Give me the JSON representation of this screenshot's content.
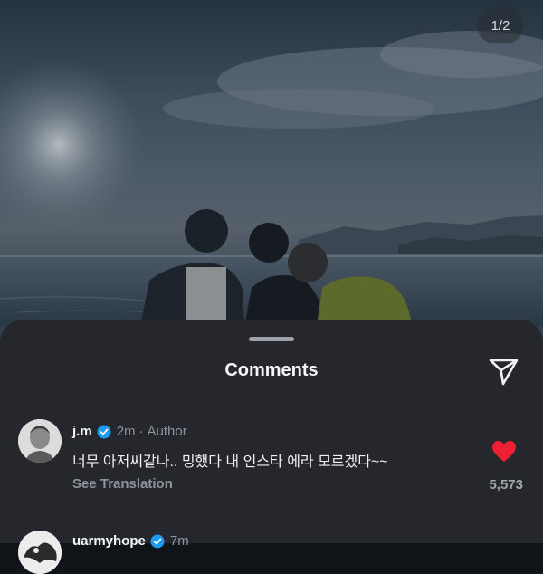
{
  "photo": {
    "counter": "1/2"
  },
  "comments_sheet": {
    "title": "Comments",
    "share_icon": "paper-plane-icon"
  },
  "comments": [
    {
      "username": "j.m",
      "verified": true,
      "time": "2m",
      "tag": "Author",
      "text": "너무 아저씨같나.. 밍했다 내 인스타 에라 모르겠다~~",
      "see_translation": "See Translation",
      "liked": true,
      "like_color": "#ed1f33",
      "likes": "5,573"
    },
    {
      "username": "uarmyhope",
      "verified": true,
      "time": "7m"
    }
  ],
  "colors": {
    "sheet_bg": "#25272d",
    "verified_blue": "#1d9bf0"
  }
}
